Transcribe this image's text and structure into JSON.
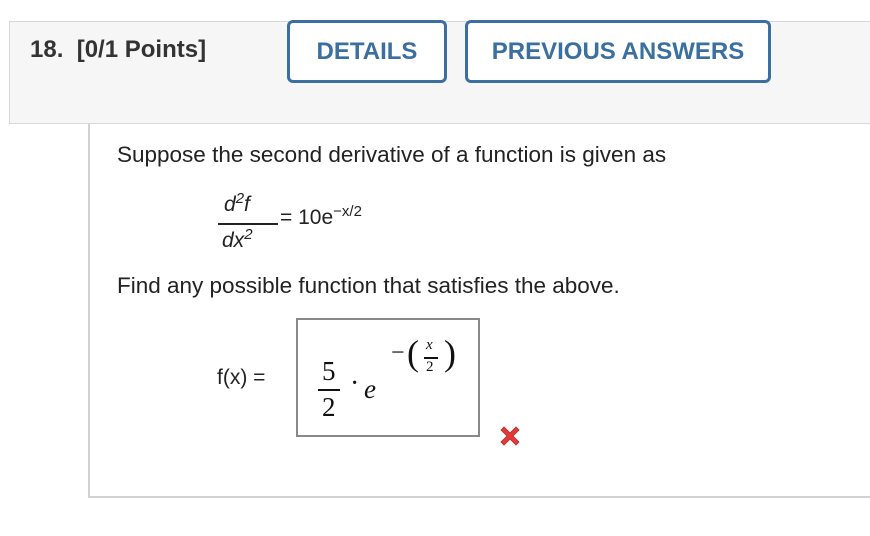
{
  "question": {
    "number": "18.",
    "points": "[0/1 Points]",
    "details_label": "DETAILS",
    "previous_answers_label": "PREVIOUS ANSWERS"
  },
  "content": {
    "prompt": "Suppose the second derivative of a function is given as",
    "equation": {
      "numerator_base": "d",
      "numerator_exp": "2",
      "numerator_var": "f",
      "denominator_base": "dx",
      "denominator_exp": "2",
      "rhs_coef": "= 10e",
      "rhs_exp": "−x/2"
    },
    "instruction": "Find any possible function that satisfies the above.",
    "fx_label": "f(x) =",
    "answer": {
      "numerator": "5",
      "denominator": "2",
      "dot": "·",
      "base": "e",
      "exp_sign": "−",
      "exp_num": "x",
      "exp_den": "2"
    },
    "status_icon": "cross-icon",
    "colors": {
      "button_accent": "#3a6f9f",
      "wrong_red": "#e23a3a"
    }
  }
}
